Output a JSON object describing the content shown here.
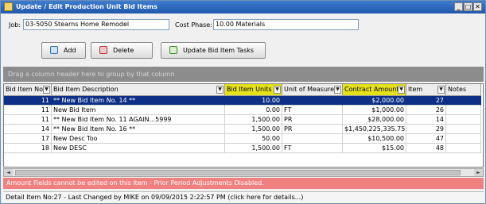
{
  "window": {
    "title": "Update / Edit Production Unit Bid Items",
    "min": "_",
    "max": "□",
    "close": "✕"
  },
  "form": {
    "job_label": "Job:",
    "job_value": "03-5050 Stearns Home Remodel",
    "cost_phase_label": "Cost Phase:",
    "cost_phase_value": "10.00 Materials"
  },
  "toolbar": {
    "add_label": "Add",
    "delete_label": "Delete",
    "update_label": "Update Bid Item Tasks"
  },
  "group_area": "Drag a column header here to group by that column",
  "grid": {
    "columns": [
      "Bid Item No",
      "Bid Item Description",
      "Bid Item Units",
      "Unit of Measure",
      "Contract Amount",
      "Item",
      "Notes"
    ],
    "rows": [
      {
        "no": "11",
        "desc": "** New Bid Item No. 14 **",
        "units": "10.00",
        "uom": "",
        "amount": "$2,000.00",
        "item": "27",
        "notes": "",
        "selected": true
      },
      {
        "no": "11",
        "desc": "New Bid Item",
        "units": "0.00",
        "uom": "FT",
        "amount": "$1,000.00",
        "item": "26",
        "notes": "",
        "selected": false
      },
      {
        "no": "11",
        "desc": "** New Bid Item No. 11 AGAIN...5999",
        "units": "1,500.00",
        "uom": "PR",
        "amount": "$28,000.00",
        "item": "14",
        "notes": "",
        "selected": false
      },
      {
        "no": "14",
        "desc": "** New Bid Item No. 16 **",
        "units": "1,500.00",
        "uom": "PR",
        "amount": "$1,450,225,335.75",
        "item": "29",
        "notes": "",
        "selected": false
      },
      {
        "no": "17",
        "desc": "New Desc Too",
        "units": "50.00",
        "uom": "",
        "amount": "$10,500.00",
        "item": "47",
        "notes": "",
        "selected": false
      },
      {
        "no": "18",
        "desc": "New DESC",
        "units": "1,500.00",
        "uom": "FT",
        "amount": "$15.00",
        "item": "48",
        "notes": "",
        "selected": false
      }
    ]
  },
  "scroll": {
    "left": "◄",
    "right": "►"
  },
  "warning": "Amount Fields cannot be edited on this Item - Prior Period Adjustments Disabled.",
  "status": "Detail Item No:27 - Last Changed by MIKE on 09/09/2015 2:22:57 PM (click here for details...)",
  "colors": {
    "highlight_header": "#e6e21a",
    "selected_row": "#0d2f86",
    "warning_bg": "#f08080",
    "title_bar": "#2a62b9"
  }
}
